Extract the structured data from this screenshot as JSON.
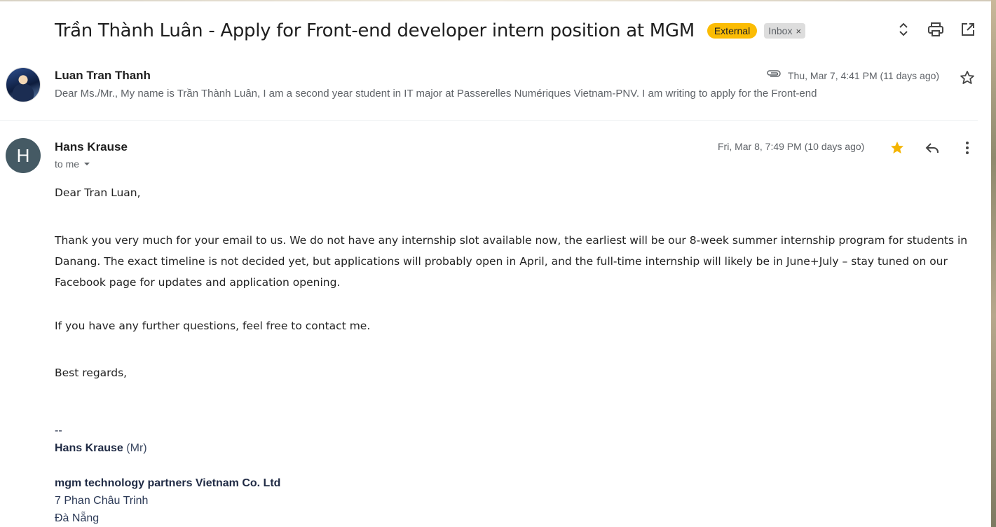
{
  "subject": {
    "title": "Trần Thành Luân - Apply for Front-end developer intern position at MGM",
    "label_external": "External",
    "label_inbox": "Inbox",
    "label_inbox_remove": "×"
  },
  "toolbar_icons": [
    "expand-collapse-icon",
    "print-icon",
    "open-in-new-window-icon"
  ],
  "message1": {
    "sender": "Luan Tran Thanh",
    "snippet": "Dear Ms./Mr., My name is Trần Thành Luân, I am a second year student in IT major at Passerelles Numériques Vietnam-PNV. I am writing to apply for the Front-end",
    "date": "Thu, Mar 7, 4:41 PM (11 days ago)",
    "has_attachment": true,
    "starred": false
  },
  "message2": {
    "avatar_letter": "H",
    "sender": "Hans Krause",
    "to": "to me",
    "date": "Fri, Mar 8, 7:49 PM (10 days ago)",
    "starred": true,
    "greeting": "Dear Tran Luan,",
    "paragraph1": "Thank you very much for your email to us. We do not have any internship slot available now, the earliest will be our 8-week summer internship program for students in Danang. The exact timeline is not decided yet, but applications will probably open in April, and the full-time internship will likely be in June+July – stay tuned on our Facebook page for updates and application opening.",
    "paragraph2": "If you have any further questions, feel free to contact me.",
    "closing": "Best regards,",
    "signature": {
      "separator": "--",
      "name": "Hans Krause",
      "title": "(Mr)",
      "company": "mgm technology partners Vietnam Co. Ltd",
      "address_line1": "7 Phan Châu Trinh",
      "address_line2": "Đà Nẵng"
    }
  },
  "colors": {
    "external_label": "#fbbc04",
    "inbox_label": "#dddddd",
    "avatar_h": "#455a64",
    "star_active": "#f4b400"
  }
}
